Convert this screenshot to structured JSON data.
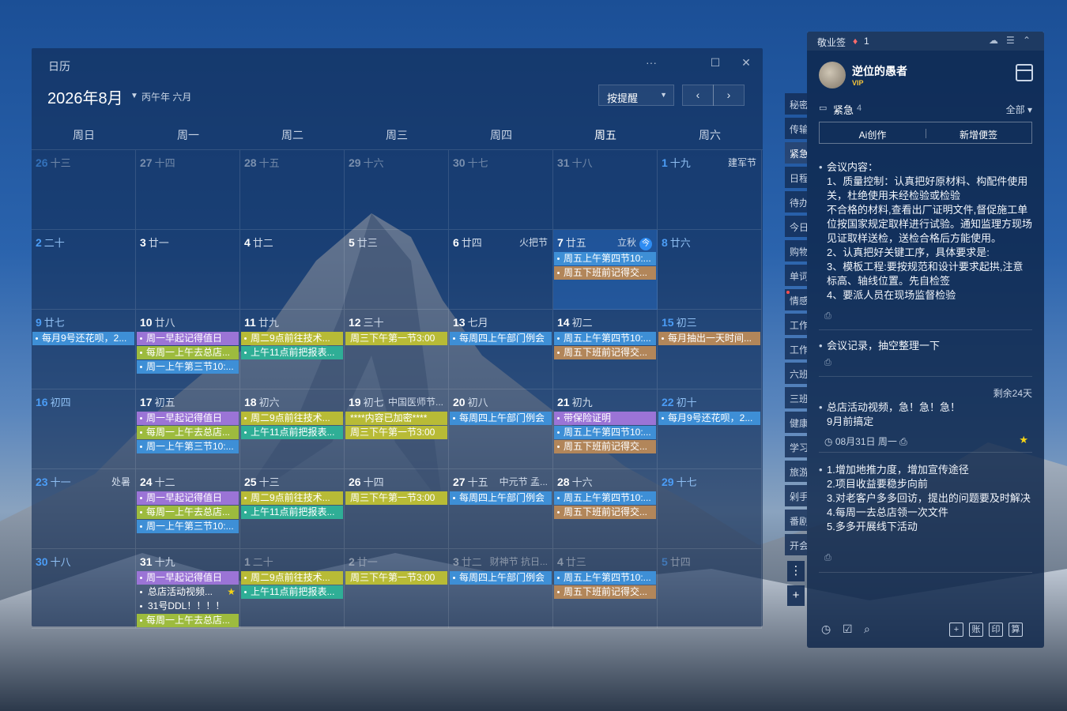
{
  "calendar": {
    "window_title": "日历",
    "month_title": "2026年8月",
    "lunar_info": "丙午年 六月",
    "remind_button": "按提醒",
    "prev_icon": "‹",
    "next_icon": "›",
    "more_icon": "···",
    "maximize_icon": "☐",
    "close_icon": "✕",
    "weekdays": [
      "周日",
      "周一",
      "周二",
      "周三",
      "周四",
      "周五",
      "周六"
    ],
    "cells": [
      {
        "day": "26",
        "lunar": "十三",
        "other": true,
        "weekend": true,
        "fest": "",
        "events": []
      },
      {
        "day": "27",
        "lunar": "十四",
        "other": true,
        "weekend": false,
        "fest": "",
        "events": []
      },
      {
        "day": "28",
        "lunar": "十五",
        "other": true,
        "weekend": false,
        "fest": "",
        "events": []
      },
      {
        "day": "29",
        "lunar": "十六",
        "other": true,
        "weekend": false,
        "fest": "",
        "events": []
      },
      {
        "day": "30",
        "lunar": "十七",
        "other": true,
        "weekend": false,
        "fest": "",
        "events": []
      },
      {
        "day": "31",
        "lunar": "十八",
        "other": true,
        "weekend": false,
        "fest": "",
        "events": []
      },
      {
        "day": "1",
        "lunar": "十九",
        "other": false,
        "weekend": true,
        "fest": "建军节",
        "events": []
      },
      {
        "day": "2",
        "lunar": "二十",
        "other": false,
        "weekend": true,
        "fest": "",
        "events": []
      },
      {
        "day": "3",
        "lunar": "廿一",
        "other": false,
        "weekend": false,
        "fest": "",
        "events": []
      },
      {
        "day": "4",
        "lunar": "廿二",
        "other": false,
        "weekend": false,
        "fest": "",
        "events": []
      },
      {
        "day": "5",
        "lunar": "廿三",
        "other": false,
        "weekend": false,
        "fest": "",
        "events": []
      },
      {
        "day": "6",
        "lunar": "廿四",
        "other": false,
        "weekend": false,
        "fest": "火把节",
        "events": []
      },
      {
        "day": "7",
        "lunar": "廿五",
        "other": false,
        "weekend": false,
        "fest": "立秋",
        "today": true,
        "badge": "今",
        "events": [
          {
            "text": "周五上午第四节10:...",
            "color": "#3e8fd6",
            "dot": true
          },
          {
            "text": "周五下班前记得交...",
            "color": "#b2865a",
            "dot": true
          }
        ]
      },
      {
        "day": "8",
        "lunar": "廿六",
        "other": false,
        "weekend": true,
        "fest": "",
        "events": []
      },
      {
        "day": "9",
        "lunar": "廿七",
        "other": false,
        "weekend": true,
        "fest": "",
        "events": [
          {
            "text": "每月9号还花呗，2...",
            "color": "#3e8fd6",
            "dot": true
          }
        ]
      },
      {
        "day": "10",
        "lunar": "廿八",
        "other": false,
        "weekend": false,
        "fest": "",
        "events": [
          {
            "text": "周一早起记得值日",
            "color": "#9b74d6",
            "dot": true
          },
          {
            "text": "每周一上午去总店...",
            "color": "#9dbb3e",
            "dot": true
          },
          {
            "text": "周一上午第三节10:...",
            "color": "#3e8fd6",
            "dot": true
          }
        ]
      },
      {
        "day": "11",
        "lunar": "廿九",
        "other": false,
        "weekend": false,
        "fest": "",
        "events": [
          {
            "text": "周二9点前往技术...",
            "color": "#b8bb36",
            "dot": true
          },
          {
            "text": "上午11点前把报表...",
            "color": "#2fae96",
            "dot": true
          }
        ]
      },
      {
        "day": "12",
        "lunar": "三十",
        "other": false,
        "weekend": false,
        "fest": "",
        "events": [
          {
            "text": "周三下午第一节3:00",
            "color": "#b8bb36",
            "dot": false
          }
        ]
      },
      {
        "day": "13",
        "lunar": "七月",
        "other": false,
        "weekend": false,
        "fest": "",
        "events": [
          {
            "text": "每周四上午部门例会",
            "color": "#3e8fd6",
            "dot": true
          }
        ]
      },
      {
        "day": "14",
        "lunar": "初二",
        "other": false,
        "weekend": false,
        "fest": "",
        "events": [
          {
            "text": "周五上午第四节10:...",
            "color": "#3e8fd6",
            "dot": true
          },
          {
            "text": "周五下班前记得交...",
            "color": "#b2865a",
            "dot": true
          }
        ]
      },
      {
        "day": "15",
        "lunar": "初三",
        "other": false,
        "weekend": true,
        "fest": "",
        "events": [
          {
            "text": "每月抽出一天时间...",
            "color": "#b2865a",
            "dot": true
          }
        ]
      },
      {
        "day": "16",
        "lunar": "初四",
        "other": false,
        "weekend": true,
        "fest": "",
        "events": []
      },
      {
        "day": "17",
        "lunar": "初五",
        "other": false,
        "weekend": false,
        "fest": "",
        "events": [
          {
            "text": "周一早起记得值日",
            "color": "#9b74d6",
            "dot": true
          },
          {
            "text": "每周一上午去总店...",
            "color": "#9dbb3e",
            "dot": true
          },
          {
            "text": "周一上午第三节10:...",
            "color": "#3e8fd6",
            "dot": true
          }
        ]
      },
      {
        "day": "18",
        "lunar": "初六",
        "other": false,
        "weekend": false,
        "fest": "",
        "events": [
          {
            "text": "周二9点前往技术...",
            "color": "#b8bb36",
            "dot": true
          },
          {
            "text": "上午11点前把报表...",
            "color": "#2fae96",
            "dot": true
          }
        ]
      },
      {
        "day": "19",
        "lunar": "初七",
        "other": false,
        "weekend": false,
        "fest": "中国医师节...",
        "events": [
          {
            "text": "****内容已加密****",
            "color": "#b8bb36",
            "dot": false
          },
          {
            "text": "周三下午第一节3:00",
            "color": "#b8bb36",
            "dot": false
          }
        ]
      },
      {
        "day": "20",
        "lunar": "初八",
        "other": false,
        "weekend": false,
        "fest": "",
        "events": [
          {
            "text": "每周四上午部门例会",
            "color": "#3e8fd6",
            "dot": true
          }
        ]
      },
      {
        "day": "21",
        "lunar": "初九",
        "other": false,
        "weekend": false,
        "fest": "",
        "events": [
          {
            "text": "带保险证明",
            "color": "#9b74d6",
            "dot": true
          },
          {
            "text": "周五上午第四节10:...",
            "color": "#3e8fd6",
            "dot": true
          },
          {
            "text": "周五下班前记得交...",
            "color": "#b2865a",
            "dot": true
          }
        ]
      },
      {
        "day": "22",
        "lunar": "初十",
        "other": false,
        "weekend": true,
        "fest": "",
        "events": [
          {
            "text": "每月9号还花呗，2...",
            "color": "#3e8fd6",
            "dot": true
          }
        ]
      },
      {
        "day": "23",
        "lunar": "十一",
        "other": false,
        "weekend": true,
        "fest": "处暑",
        "events": []
      },
      {
        "day": "24",
        "lunar": "十二",
        "other": false,
        "weekend": false,
        "fest": "",
        "events": [
          {
            "text": "周一早起记得值日",
            "color": "#9b74d6",
            "dot": true
          },
          {
            "text": "每周一上午去总店...",
            "color": "#9dbb3e",
            "dot": true
          },
          {
            "text": "周一上午第三节10:...",
            "color": "#3e8fd6",
            "dot": true
          }
        ]
      },
      {
        "day": "25",
        "lunar": "十三",
        "other": false,
        "weekend": false,
        "fest": "",
        "events": [
          {
            "text": "周二9点前往技术...",
            "color": "#b8bb36",
            "dot": true
          },
          {
            "text": "上午11点前把报表...",
            "color": "#2fae96",
            "dot": true
          }
        ]
      },
      {
        "day": "26",
        "lunar": "十四",
        "other": false,
        "weekend": false,
        "fest": "",
        "events": [
          {
            "text": "周三下午第一节3:00",
            "color": "#b8bb36",
            "dot": false
          }
        ]
      },
      {
        "day": "27",
        "lunar": "十五",
        "other": false,
        "weekend": false,
        "fest": "中元节 孟...",
        "events": [
          {
            "text": "每周四上午部门例会",
            "color": "#3e8fd6",
            "dot": true
          }
        ]
      },
      {
        "day": "28",
        "lunar": "十六",
        "other": false,
        "weekend": false,
        "fest": "",
        "events": [
          {
            "text": "周五上午第四节10:...",
            "color": "#3e8fd6",
            "dot": true
          },
          {
            "text": "周五下班前记得交...",
            "color": "#b2865a",
            "dot": true
          }
        ]
      },
      {
        "day": "29",
        "lunar": "十七",
        "other": false,
        "weekend": true,
        "fest": "",
        "events": []
      },
      {
        "day": "30",
        "lunar": "十八",
        "other": false,
        "weekend": true,
        "fest": "",
        "events": []
      },
      {
        "day": "31",
        "lunar": "十九",
        "other": false,
        "weekend": false,
        "fest": "",
        "events": [
          {
            "text": "周一早起记得值日",
            "color": "#9b74d6",
            "dot": true
          },
          {
            "text": "总店活动视频...",
            "color": "plain",
            "dot": true,
            "star": true
          },
          {
            "text": "31号DDL！！！！",
            "color": "plain",
            "dot": true
          },
          {
            "text": "每周一上午去总店...",
            "color": "#9dbb3e",
            "dot": true
          }
        ]
      },
      {
        "day": "1",
        "lunar": "二十",
        "other": true,
        "weekend": false,
        "fest": "",
        "events": [
          {
            "text": "周二9点前往技术...",
            "color": "#b8bb36",
            "dot": true
          },
          {
            "text": "上午11点前把报表...",
            "color": "#2fae96",
            "dot": true
          }
        ]
      },
      {
        "day": "2",
        "lunar": "廿一",
        "other": true,
        "weekend": false,
        "fest": "",
        "events": [
          {
            "text": "周三下午第一节3:00",
            "color": "#b8bb36",
            "dot": false
          }
        ]
      },
      {
        "day": "3",
        "lunar": "廿二",
        "other": true,
        "weekend": false,
        "fest": "财神节 抗日...",
        "events": [
          {
            "text": "每周四上午部门例会",
            "color": "#3e8fd6",
            "dot": true
          }
        ]
      },
      {
        "day": "4",
        "lunar": "廿三",
        "other": true,
        "weekend": false,
        "fest": "",
        "events": [
          {
            "text": "周五上午第四节10:...",
            "color": "#3e8fd6",
            "dot": true
          },
          {
            "text": "周五下班前记得交...",
            "color": "#b2865a",
            "dot": true
          }
        ]
      },
      {
        "day": "5",
        "lunar": "廿四",
        "other": true,
        "weekend": true,
        "fest": "",
        "events": []
      }
    ]
  },
  "side_tabs": [
    "秘密",
    "传输",
    "紧急",
    "日程",
    "待办",
    "今日",
    "购物",
    "单词",
    "情感",
    "工作",
    "工作",
    "六班",
    "三班",
    "健康",
    "学习",
    "旅游",
    "剁手",
    "番剧",
    "开会"
  ],
  "side_more": "⋮",
  "side_add": "+",
  "notes": {
    "app_name": "敬业签",
    "bell_icon": "🔔",
    "bell_count": "1",
    "username": "逆位的愚者",
    "vip": "VIP",
    "category": "紧急",
    "category_count": "4",
    "filter": "全部 ▾",
    "ai_button": "Ai创作",
    "new_button": "新增便签",
    "items": [
      {
        "text": "会议内容：\n1、质量控制：认真把好原材料、构配件使用关，杜绝使用未经检验或检验\n不合格的材料,查看出厂证明文件,督促施工单位按国家规定取样进行试验。通知监理方现场见证取样送检，送检合格后方能使用。\n2、认真把好关键工序，具体要求是:\n3、模板工程:要按规范和设计要求起拱,注意标高、轴线位置。先自检签\n4、要派人员在现场监督检验"
      },
      {
        "text": "会议记录，抽空整理一下"
      },
      {
        "text": "总店活动视频，急！急！急！\n9月前搞定",
        "remain": "剩余24天",
        "meta": "08月31日 周一"
      },
      {
        "text": "1.增加地推力度，增加宣传途径\n2.项目收益要稳步向前\n3.对老客户多多回访，提出的问题要及时解决\n4.每周一去总店领一次文件\n5.多多开展线下活动"
      }
    ],
    "bottom_icons": [
      "账",
      "印",
      "算"
    ]
  }
}
